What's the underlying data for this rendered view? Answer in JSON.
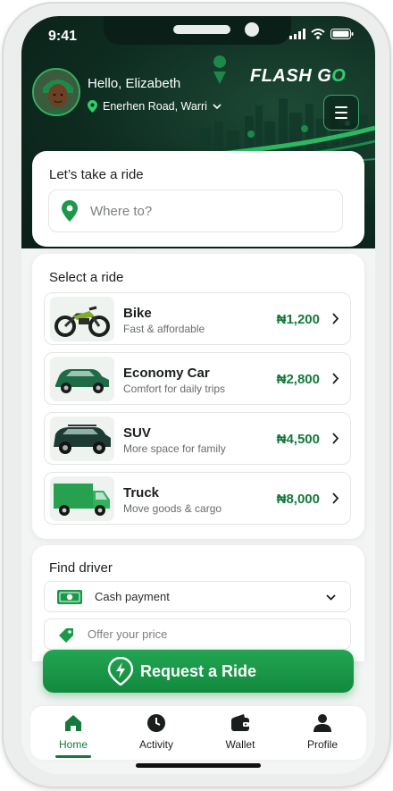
{
  "status_bar": {
    "time": "9:41"
  },
  "header": {
    "greeting": "Hello, Elizabeth",
    "location": "Enerhen Road, Warri",
    "brand_prefix": "FLASH G",
    "brand_suffix": "O",
    "menu_icon": "menu-icon"
  },
  "ride_card": {
    "title": "Let’s take a ride",
    "search_placeholder": "Where to?"
  },
  "select_card": {
    "title": "Select a ride",
    "options": [
      {
        "name": "Bike",
        "description": "Fast & affordable",
        "price": "₦1,200",
        "icon": "motorbike"
      },
      {
        "name": "Economy Car",
        "description": "Comfort for daily trips",
        "price": "₦2,800",
        "icon": "car"
      },
      {
        "name": "SUV",
        "description": "More space for family",
        "price": "₦4,500",
        "icon": "suv"
      },
      {
        "name": "Truck",
        "description": "Move goods & cargo",
        "price": "₦8,000",
        "icon": "truck"
      }
    ]
  },
  "driver_card": {
    "title": "Find driver",
    "payment_method": "Cash payment",
    "offer_placeholder": "Offer your price"
  },
  "request_button": {
    "label": "Request a Ride"
  },
  "tabs": [
    {
      "label": "Home",
      "icon": "home-icon",
      "active": true
    },
    {
      "label": "Activity",
      "icon": "clock-icon",
      "active": false
    },
    {
      "label": "Wallet",
      "icon": "wallet-icon",
      "active": false
    },
    {
      "label": "Profile",
      "icon": "user-icon",
      "active": false
    }
  ],
  "colors": {
    "brand_green": "#137a3a",
    "header_dark": "#0e2b20",
    "button_green": "#1a9a48"
  }
}
